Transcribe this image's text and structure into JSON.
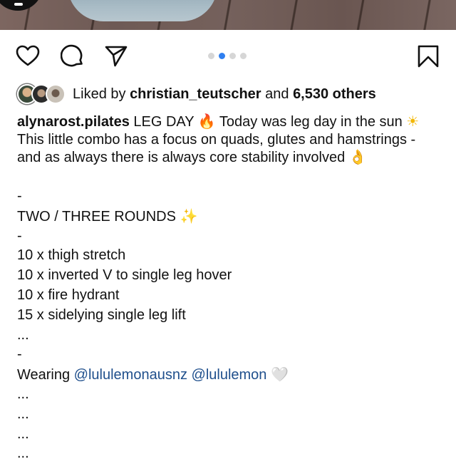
{
  "actions": {
    "like_icon": "heart-outline-icon",
    "comment_icon": "comment-bubble-icon",
    "share_icon": "paper-plane-icon",
    "save_icon": "bookmark-outline-icon"
  },
  "carousel": {
    "count": 4,
    "active_index": 1,
    "active_color": "#2f7ff0"
  },
  "likes": {
    "prefix": "Liked by ",
    "user": "christian_teutscher",
    "middle": " and ",
    "count": "6,530 others"
  },
  "caption": {
    "username": "alynarost.pilates",
    "part1": " LEG DAY ",
    "emoji_fire": "🔥",
    "part2": " Today was leg day in the sun ",
    "emoji_sun": "☀",
    "part3": " This little combo has a focus on quads, glutes and hamstrings - and as always there is always core stability involved ",
    "emoji_ok": "👌"
  },
  "lines": {
    "dash1": "-",
    "rounds": "TWO / THREE ROUNDS ",
    "emoji_sparkles": "✨",
    "dash2": "-",
    "exercise1": "10 x thigh stretch",
    "exercise2": "10 x inverted V to single leg hover",
    "exercise3": "10 x fire hydrant",
    "exercise4": "15 x sidelying single leg lift",
    "ellipsis1": "...",
    "dash3": "-",
    "wearing_prefix": "Wearing ",
    "mention1": "@lululemonausnz",
    "mention_sep": " ",
    "mention2": "@lululemon",
    "emoji_heart": "🤍",
    "ellipsis2": "...",
    "ellipsis3": "...",
    "ellipsis4": "...",
    "ellipsis5": "..."
  }
}
